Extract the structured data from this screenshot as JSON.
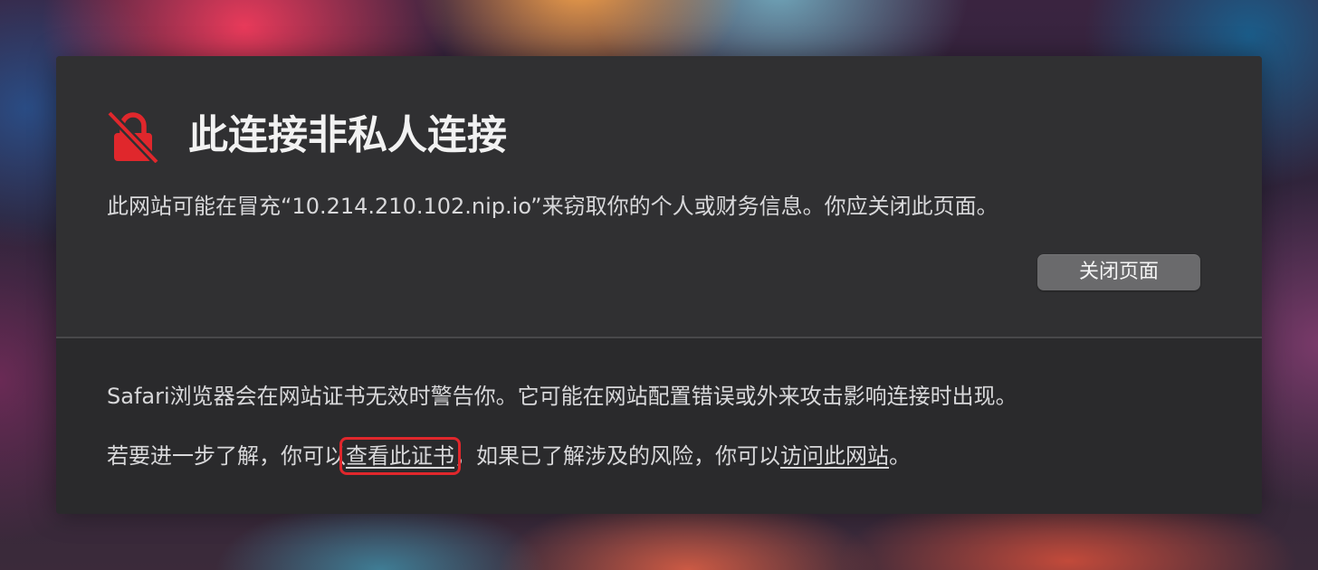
{
  "warning_page": {
    "title": "此连接非私人连接",
    "message": "此网站可能在冒充“10.214.210.102.nip.io”来窃取你的个人或财务信息。你应关闭此页面。",
    "close_button_label": "关闭页面",
    "explanation": "Safari浏览器会在网站证书无效时警告你。它可能在网站配置错误或外来攻击影响连接时出现。",
    "options": {
      "prefix": "若要进一步了解，你可以",
      "view_certificate_link": "查看此证书",
      "middle": "，如果已了解涉及的风险，你可以",
      "visit_site_link": "访问此网站",
      "suffix": "。"
    },
    "icon": "lock-slash-icon",
    "colors": {
      "icon_red": "#e0272c",
      "highlight_red": "#e0272c",
      "panel_bg": "#303032"
    }
  }
}
